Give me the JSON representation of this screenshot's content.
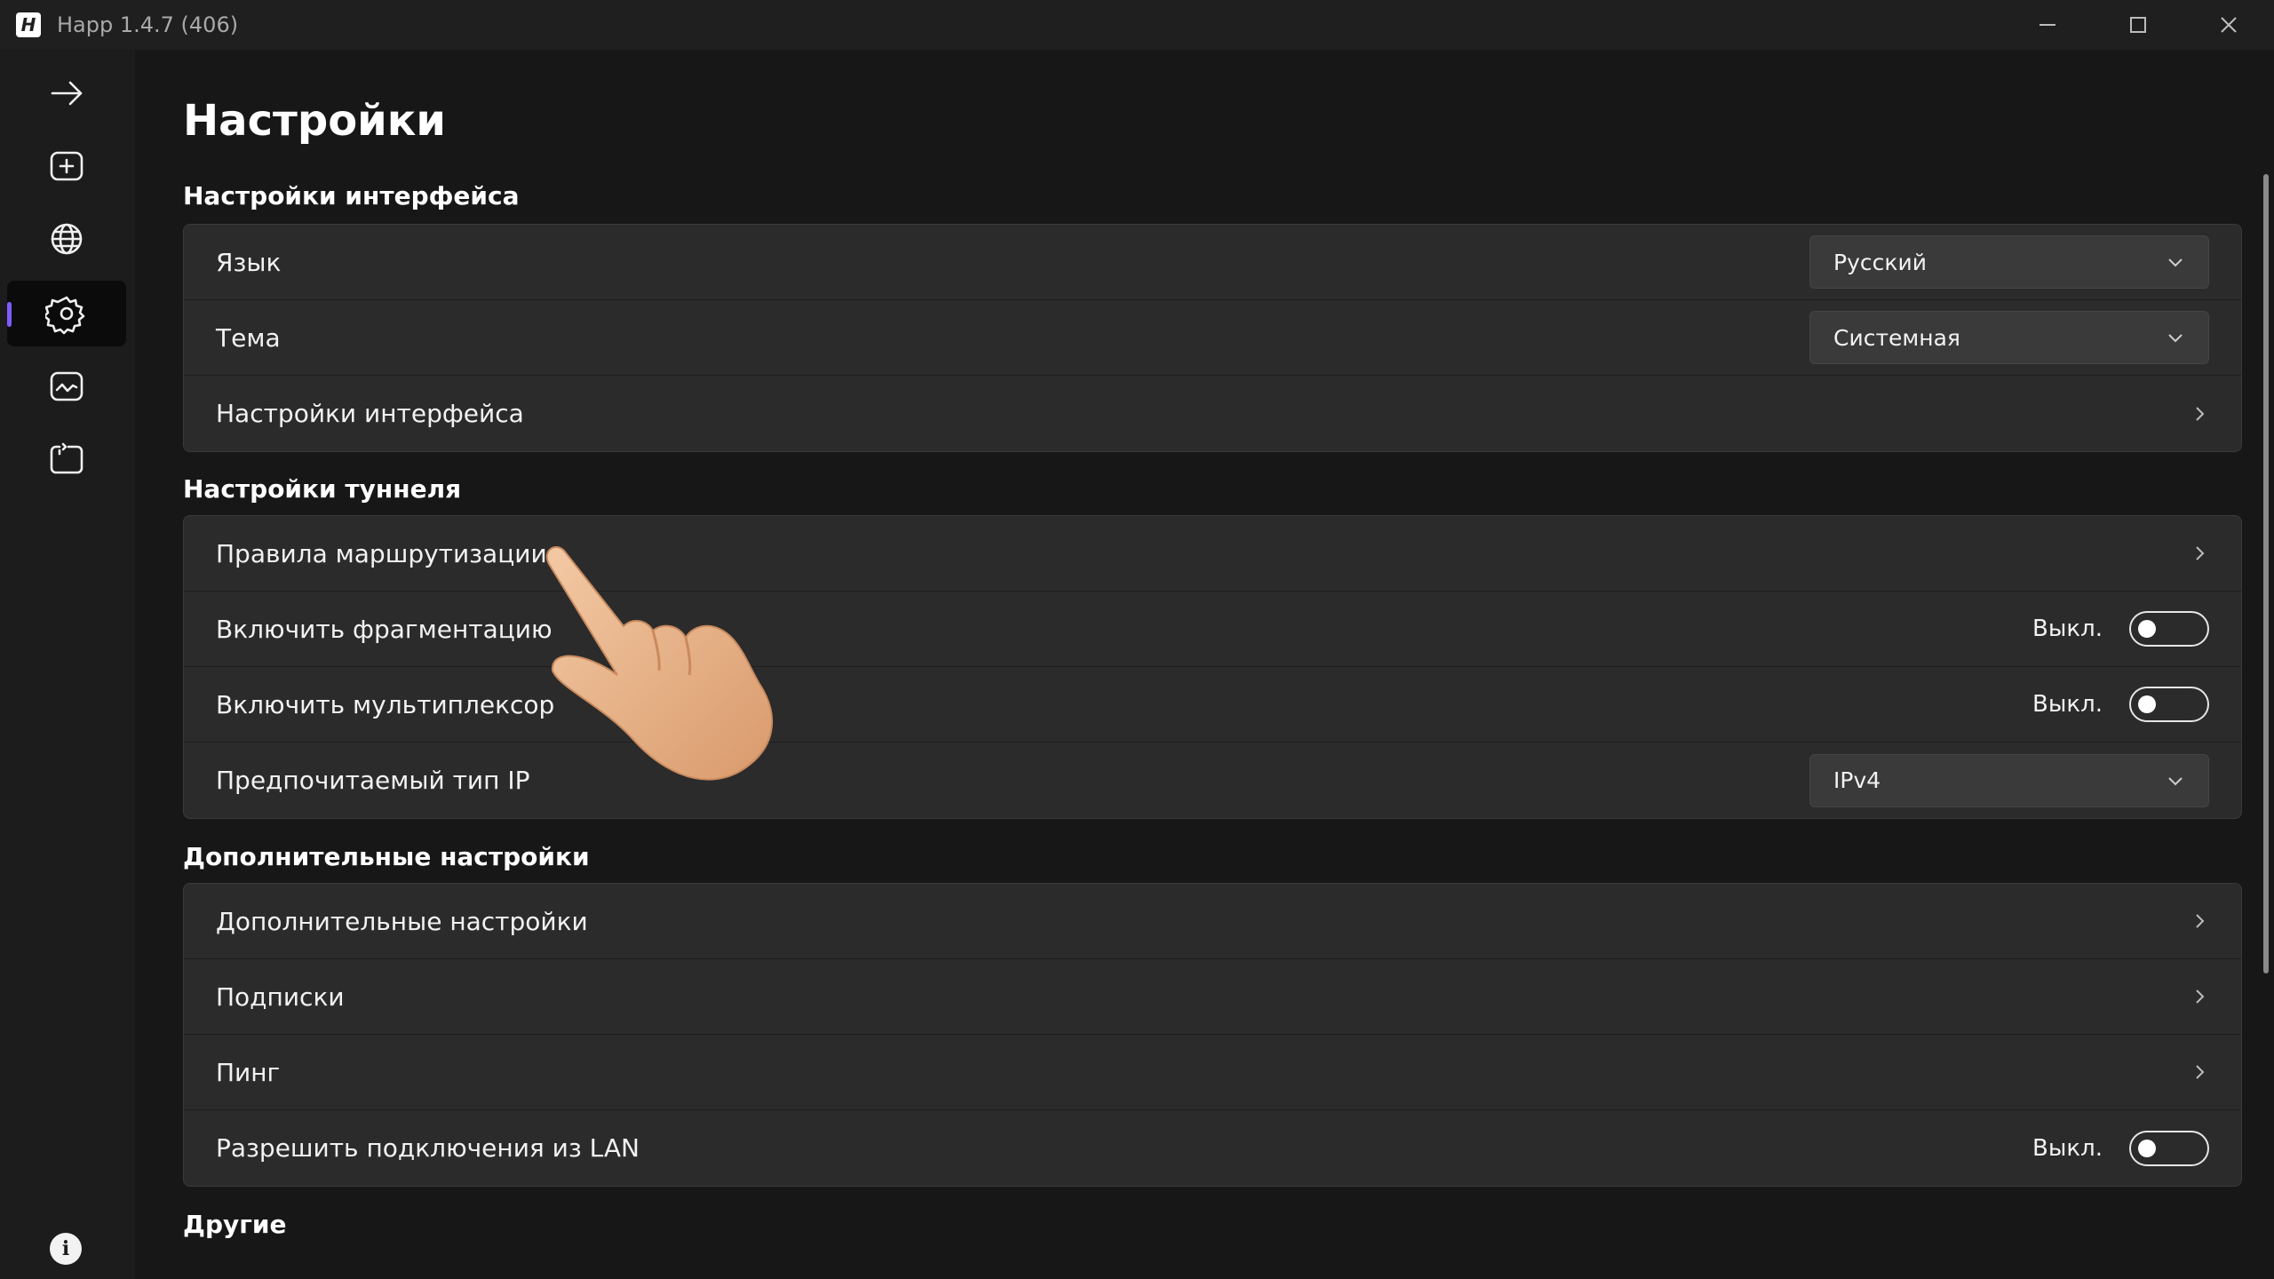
{
  "window": {
    "logo_letter": "H",
    "title": "Happ 1.4.7 (406)"
  },
  "sidebar": {
    "items": [
      {
        "icon": "arrow-right-icon"
      },
      {
        "icon": "add-box-icon"
      },
      {
        "icon": "globe-icon"
      },
      {
        "icon": "gear-icon",
        "active": true
      },
      {
        "icon": "monitor-chart-icon"
      },
      {
        "icon": "tunnel-icon"
      }
    ],
    "info_glyph": "i",
    "accent_color": "#7c5cff"
  },
  "page": {
    "title": "Настройки"
  },
  "sections": {
    "interface": {
      "title": "Настройки интерфейса",
      "language_label": "Язык",
      "language_value": "Русский",
      "theme_label": "Тема",
      "theme_value": "Системная",
      "interface_settings_label": "Настройки интерфейса"
    },
    "tunnel": {
      "title": "Настройки туннеля",
      "routing_label": "Правила маршрутизации",
      "fragmentation_label": "Включить фрагментацию",
      "fragmentation_state": "Выкл.",
      "multiplexer_label": "Включить мультиплексор",
      "multiplexer_state": "Выкл.",
      "ip_type_label": "Предпочитаемый тип IP",
      "ip_type_value": "IPv4"
    },
    "advanced": {
      "title": "Дополнительные настройки",
      "advanced_label": "Дополнительные настройки",
      "subscriptions_label": "Подписки",
      "ping_label": "Пинг",
      "lan_label": "Разрешить подключения из LAN",
      "lan_state": "Выкл."
    },
    "other": {
      "title": "Другие"
    }
  }
}
